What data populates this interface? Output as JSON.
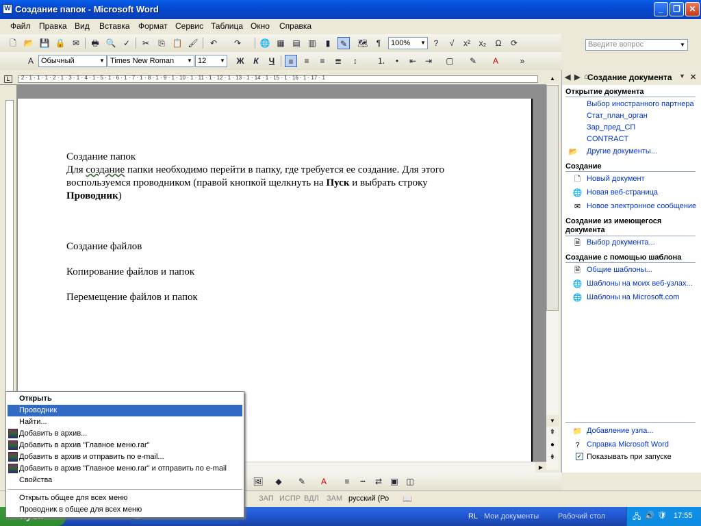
{
  "window": {
    "title": "Создание папок - Microsoft Word",
    "app_icon": "W",
    "minimize": "_",
    "restore": "❐",
    "close": "✕"
  },
  "menu": {
    "items": [
      "Файл",
      "Правка",
      "Вид",
      "Вставка",
      "Формат",
      "Сервис",
      "Таблица",
      "Окно",
      "Справка"
    ],
    "ask_placeholder": "Введите вопрос"
  },
  "toolbar": {
    "zoom": "100%"
  },
  "format_bar": {
    "style": "Обычный",
    "font": "Times New Roman",
    "size": "12",
    "bold": "Ж",
    "italic": "К",
    "underline": "Ч"
  },
  "document": {
    "heading1": "Создание папок",
    "para1_a": "Для ",
    "para1_b": "создание",
    "para1_c": " папки необходимо перейти в папку, где требуется ее создание. Для этого воспользуемся проводником (правой кнопкой щелкнуть на ",
    "para1_bold1": "Пуск",
    "para1_d": " и выбрать строку ",
    "para1_bold2": "Проводник",
    "para1_e": ")",
    "heading2": "Создание файлов",
    "heading3": "Копирование файлов и папок",
    "heading4": "Перемещение файлов и папок"
  },
  "ruler": {
    "marks": "· 2 · 1 · 1 · 1 · 2 · 1 · 3 · 1 · 4 · 1 · 5 · 1 · 6 · 1 · 7 · 1 · 8 · 1 · 9 · 1 · 10 · 1 · 11 · 1 · 12 · 1 · 13 · 1 · 14 · 1 · 15 · 1 · 16 · 1 · 17 · 1"
  },
  "taskpane": {
    "title": "Создание документа",
    "sections": {
      "open": "Открытие документа",
      "create": "Создание",
      "from_existing": "Создание из имеющегося документа",
      "from_template": "Создание с помощью шаблона"
    },
    "open_links": [
      "Выбор иностранного партнера",
      "Стат_план_орган",
      "Зар_пред_СП",
      "CONTRACT"
    ],
    "other_docs": "Другие документы...",
    "create_links": [
      "Новый документ",
      "Новая веб-страница",
      "Новое электронное сообщение"
    ],
    "choose_doc": "Выбор документа...",
    "template_links": [
      "Общие шаблоны...",
      "Шаблоны на моих веб-узлах...",
      "Шаблоны на Microsoft.com"
    ],
    "add_node": "Добавление узла...",
    "help": "Справка Microsoft Word",
    "show_startup": "Показывать при запуске"
  },
  "context_menu": {
    "items": [
      {
        "label": "Открыть",
        "bold": true
      },
      {
        "label": "Проводник",
        "highlight": true
      },
      {
        "label": "Найти..."
      },
      {
        "label": "Добавить в архив...",
        "rar": true
      },
      {
        "label": "Добавить в архив \"Главное меню.rar\"",
        "rar": true
      },
      {
        "label": "Добавить в архив и отправить по e-mail...",
        "rar": true
      },
      {
        "label": "Добавить в архив \"Главное меню.rar\" и отправить по e-mail",
        "rar": true
      },
      {
        "label": "Свойства"
      },
      {
        "label": "Открыть общее для всех меню"
      },
      {
        "label": "Проводник в общее для всех меню"
      }
    ]
  },
  "status": {
    "zap": "ЗАП",
    "ispr": "ИСПР",
    "vdl": "ВДЛ",
    "zam": "ЗАМ",
    "lang": "русский (Ро"
  },
  "taskbar": {
    "start": "пуск",
    "lang": "RL",
    "my_docs": "Мои документы",
    "desktop": "Рабочий стол",
    "time": "17:55"
  }
}
